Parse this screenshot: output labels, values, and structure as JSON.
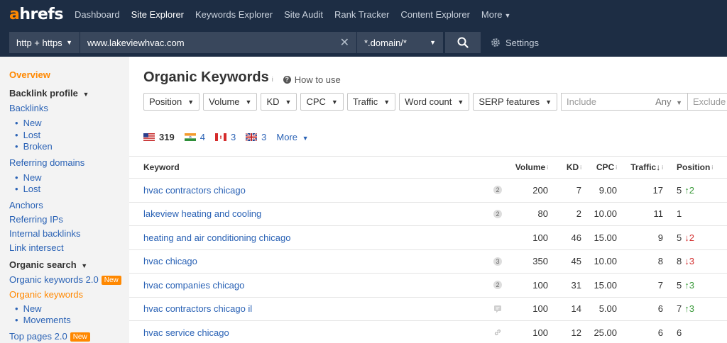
{
  "nav": {
    "logo_a": "a",
    "logo_rest": "hrefs",
    "items": [
      {
        "label": "Dashboard",
        "active": false
      },
      {
        "label": "Site Explorer",
        "active": true
      },
      {
        "label": "Keywords Explorer",
        "active": false
      },
      {
        "label": "Site Audit",
        "active": false
      },
      {
        "label": "Rank Tracker",
        "active": false
      },
      {
        "label": "Content Explorer",
        "active": false
      },
      {
        "label": "More",
        "active": false
      }
    ]
  },
  "search": {
    "protocol": "http + https",
    "url": "www.lakeviewhvac.com",
    "mode": "*.domain/*",
    "settings_label": "Settings"
  },
  "sidebar": {
    "overview": "Overview",
    "backlink_profile": "Backlink profile",
    "backlinks": "Backlinks",
    "backlinks_sub": [
      "New",
      "Lost",
      "Broken"
    ],
    "referring_domains": "Referring domains",
    "referring_domains_sub": [
      "New",
      "Lost"
    ],
    "anchors": "Anchors",
    "referring_ips": "Referring IPs",
    "internal_backlinks": "Internal backlinks",
    "link_intersect": "Link intersect",
    "organic_search": "Organic search",
    "organic_keywords_2": "Organic keywords 2.0",
    "new_badge": "New",
    "organic_keywords": "Organic keywords",
    "organic_keywords_sub": [
      "New",
      "Movements"
    ],
    "top_pages_2": "Top pages 2.0"
  },
  "main": {
    "title": "Organic Keywords",
    "title_info": "i",
    "how_to_use": "How to use",
    "filters": [
      "Position",
      "Volume",
      "KD",
      "CPC",
      "Traffic",
      "Word count",
      "SERP features"
    ],
    "include_placeholder": "Include",
    "any_label": "Any",
    "exclude_placeholder": "Exclude",
    "countries": [
      {
        "code": "us",
        "count": "319"
      },
      {
        "code": "in",
        "count": "4"
      },
      {
        "code": "ca",
        "count": "3"
      },
      {
        "code": "gb",
        "count": "3"
      }
    ],
    "more_label": "More"
  },
  "table": {
    "headers": {
      "keyword": "Keyword",
      "volume": "Volume",
      "kd": "KD",
      "cpc": "CPC",
      "traffic": "Traffic",
      "traffic_sort": "↓",
      "position": "Position",
      "info": "i"
    },
    "rows": [
      {
        "keyword": "hvac contractors chicago",
        "badge": "2",
        "badge_type": "num",
        "volume": "200",
        "kd": "7",
        "cpc": "9.00",
        "traffic": "17",
        "position": "5",
        "change": "2",
        "dir": "up"
      },
      {
        "keyword": "lakeview heating and cooling",
        "badge": "2",
        "badge_type": "num",
        "volume": "80",
        "kd": "2",
        "cpc": "10.00",
        "traffic": "11",
        "position": "1",
        "change": "",
        "dir": ""
      },
      {
        "keyword": "heating and air conditioning chicago",
        "badge": "",
        "badge_type": "",
        "volume": "100",
        "kd": "46",
        "cpc": "15.00",
        "traffic": "9",
        "position": "5",
        "change": "2",
        "dir": "down"
      },
      {
        "keyword": "hvac chicago",
        "badge": "3",
        "badge_type": "num",
        "volume": "350",
        "kd": "45",
        "cpc": "10.00",
        "traffic": "8",
        "position": "8",
        "change": "3",
        "dir": "down"
      },
      {
        "keyword": "hvac companies chicago",
        "badge": "2",
        "badge_type": "num",
        "volume": "100",
        "kd": "31",
        "cpc": "15.00",
        "traffic": "7",
        "position": "5",
        "change": "3",
        "dir": "up"
      },
      {
        "keyword": "hvac contractors chicago il",
        "badge": "",
        "badge_type": "comment",
        "volume": "100",
        "kd": "14",
        "cpc": "5.00",
        "traffic": "6",
        "position": "7",
        "change": "3",
        "dir": "up"
      },
      {
        "keyword": "hvac service chicago",
        "badge": "",
        "badge_type": "link",
        "volume": "100",
        "kd": "12",
        "cpc": "25.00",
        "traffic": "6",
        "position": "6",
        "change": "",
        "dir": ""
      }
    ]
  }
}
